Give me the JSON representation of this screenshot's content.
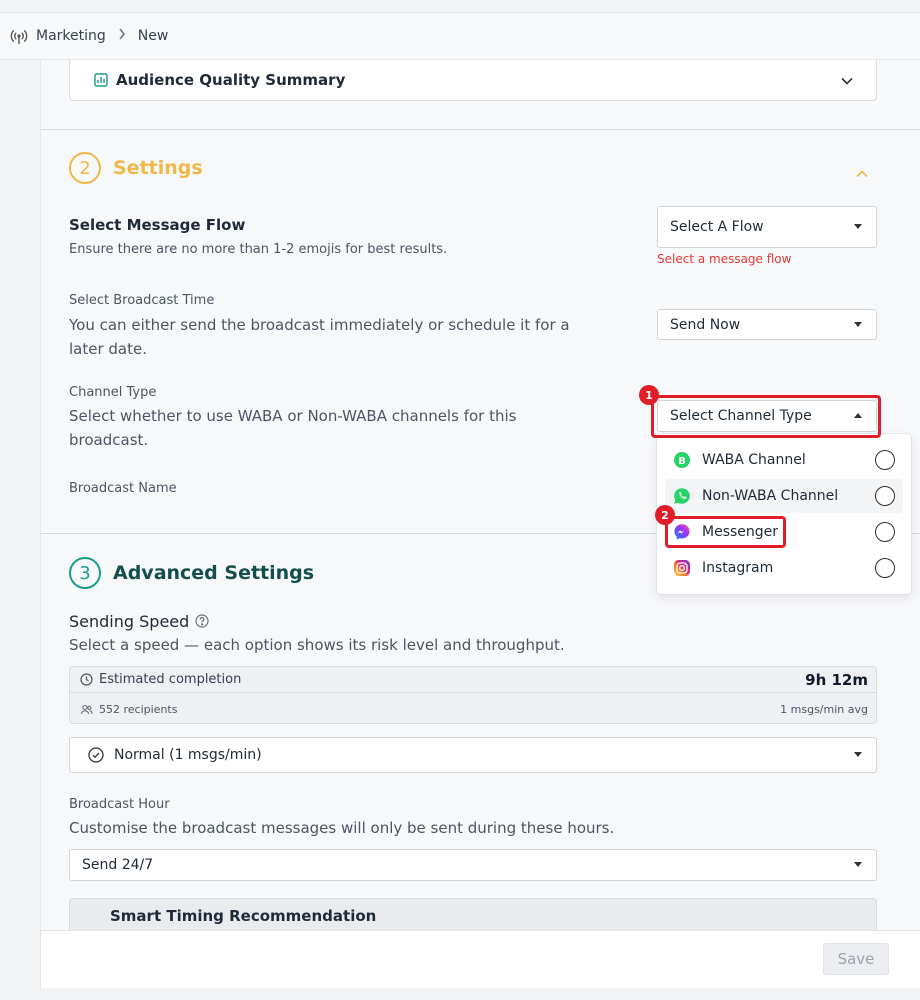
{
  "breadcrumb": {
    "root": "Marketing",
    "current": "New"
  },
  "audience_summary": {
    "title": "Audience Quality Summary"
  },
  "settings": {
    "step_number": "2",
    "title": "Settings",
    "message_flow": {
      "label": "Select Message Flow",
      "hint": "Ensure there are no more than 1-2 emojis for best results.",
      "value": "Select A Flow",
      "error": "Select a message flow"
    },
    "broadcast_time": {
      "label": "Select Broadcast Time",
      "desc_line1": "You can either send the broadcast immediately or schedule it for a",
      "desc_line2": "later date.",
      "value": "Send Now"
    },
    "channel_type": {
      "label": "Channel Type",
      "desc_line1": "Select whether to use WABA or Non-WABA channels for this",
      "desc_line2": "broadcast.",
      "value": "Select Channel Type",
      "options": [
        "WABA Channel",
        "Non-WABA Channel",
        "Messenger",
        "Instagram"
      ]
    },
    "broadcast_name": {
      "label": "Broadcast Name"
    }
  },
  "advanced": {
    "step_number": "3",
    "title": "Advanced Settings",
    "sending_speed": {
      "label": "Sending Speed",
      "desc": "Select a speed — each option shows its risk level and throughput.",
      "estimate_label": "Estimated completion",
      "estimate_value": "9h 12m",
      "recipients": "552 recipients",
      "avg": "1 msgs/min avg",
      "value": "Normal (1 msgs/min)"
    },
    "broadcast_hour": {
      "label": "Broadcast Hour",
      "desc": "Customise the broadcast messages will only be sent during these hours.",
      "value": "Send 24/7"
    },
    "smart_timing": "Smart Timing Recommendation"
  },
  "markers": [
    "1",
    "2"
  ],
  "footer": {
    "save_label": "Save"
  },
  "colors": {
    "settings_accent": "#f0b847",
    "advanced_accent": "#1a9c8a",
    "highlight": "#e11d2a",
    "error": "#e53935"
  }
}
